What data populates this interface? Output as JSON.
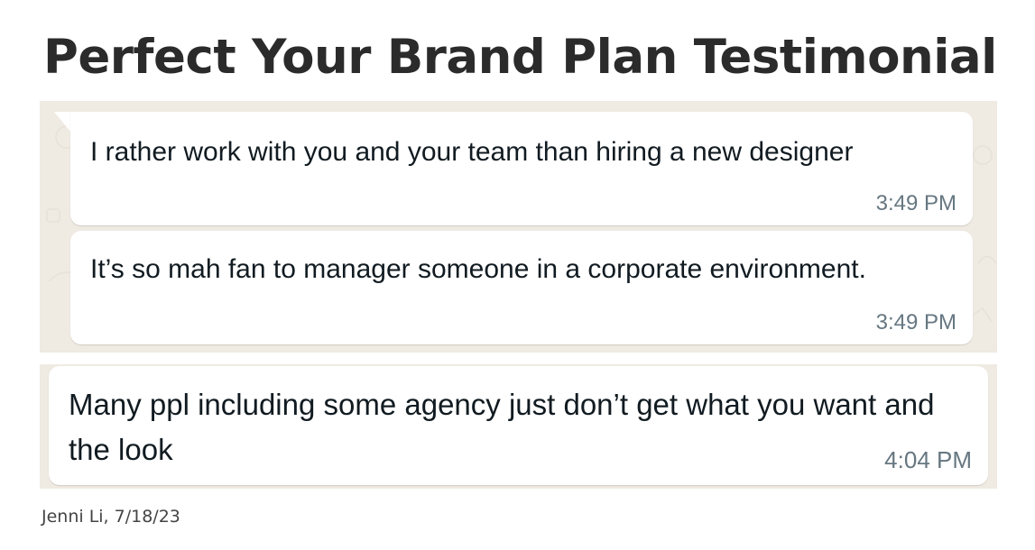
{
  "title": "Perfect Your Brand Plan Testimonial",
  "colors": {
    "chat_background": "#efeae2",
    "bubble_background": "#ffffff",
    "message_text": "#111b21",
    "timestamp_text": "#667781",
    "title_text": "#2b2b2b"
  },
  "screenshot_one": {
    "messages": [
      {
        "text": "I rather work with you and your team than hiring a new designer",
        "time": "3:49 PM"
      },
      {
        "text": "It’s so mah fan to manager someone in a corporate environment.",
        "time": "3:49 PM"
      }
    ]
  },
  "screenshot_two": {
    "messages": [
      {
        "text": "Many ppl including some agency just don’t get what you want and the look",
        "time": "4:04 PM"
      }
    ]
  },
  "caption": "Jenni Li, 7/18/23"
}
